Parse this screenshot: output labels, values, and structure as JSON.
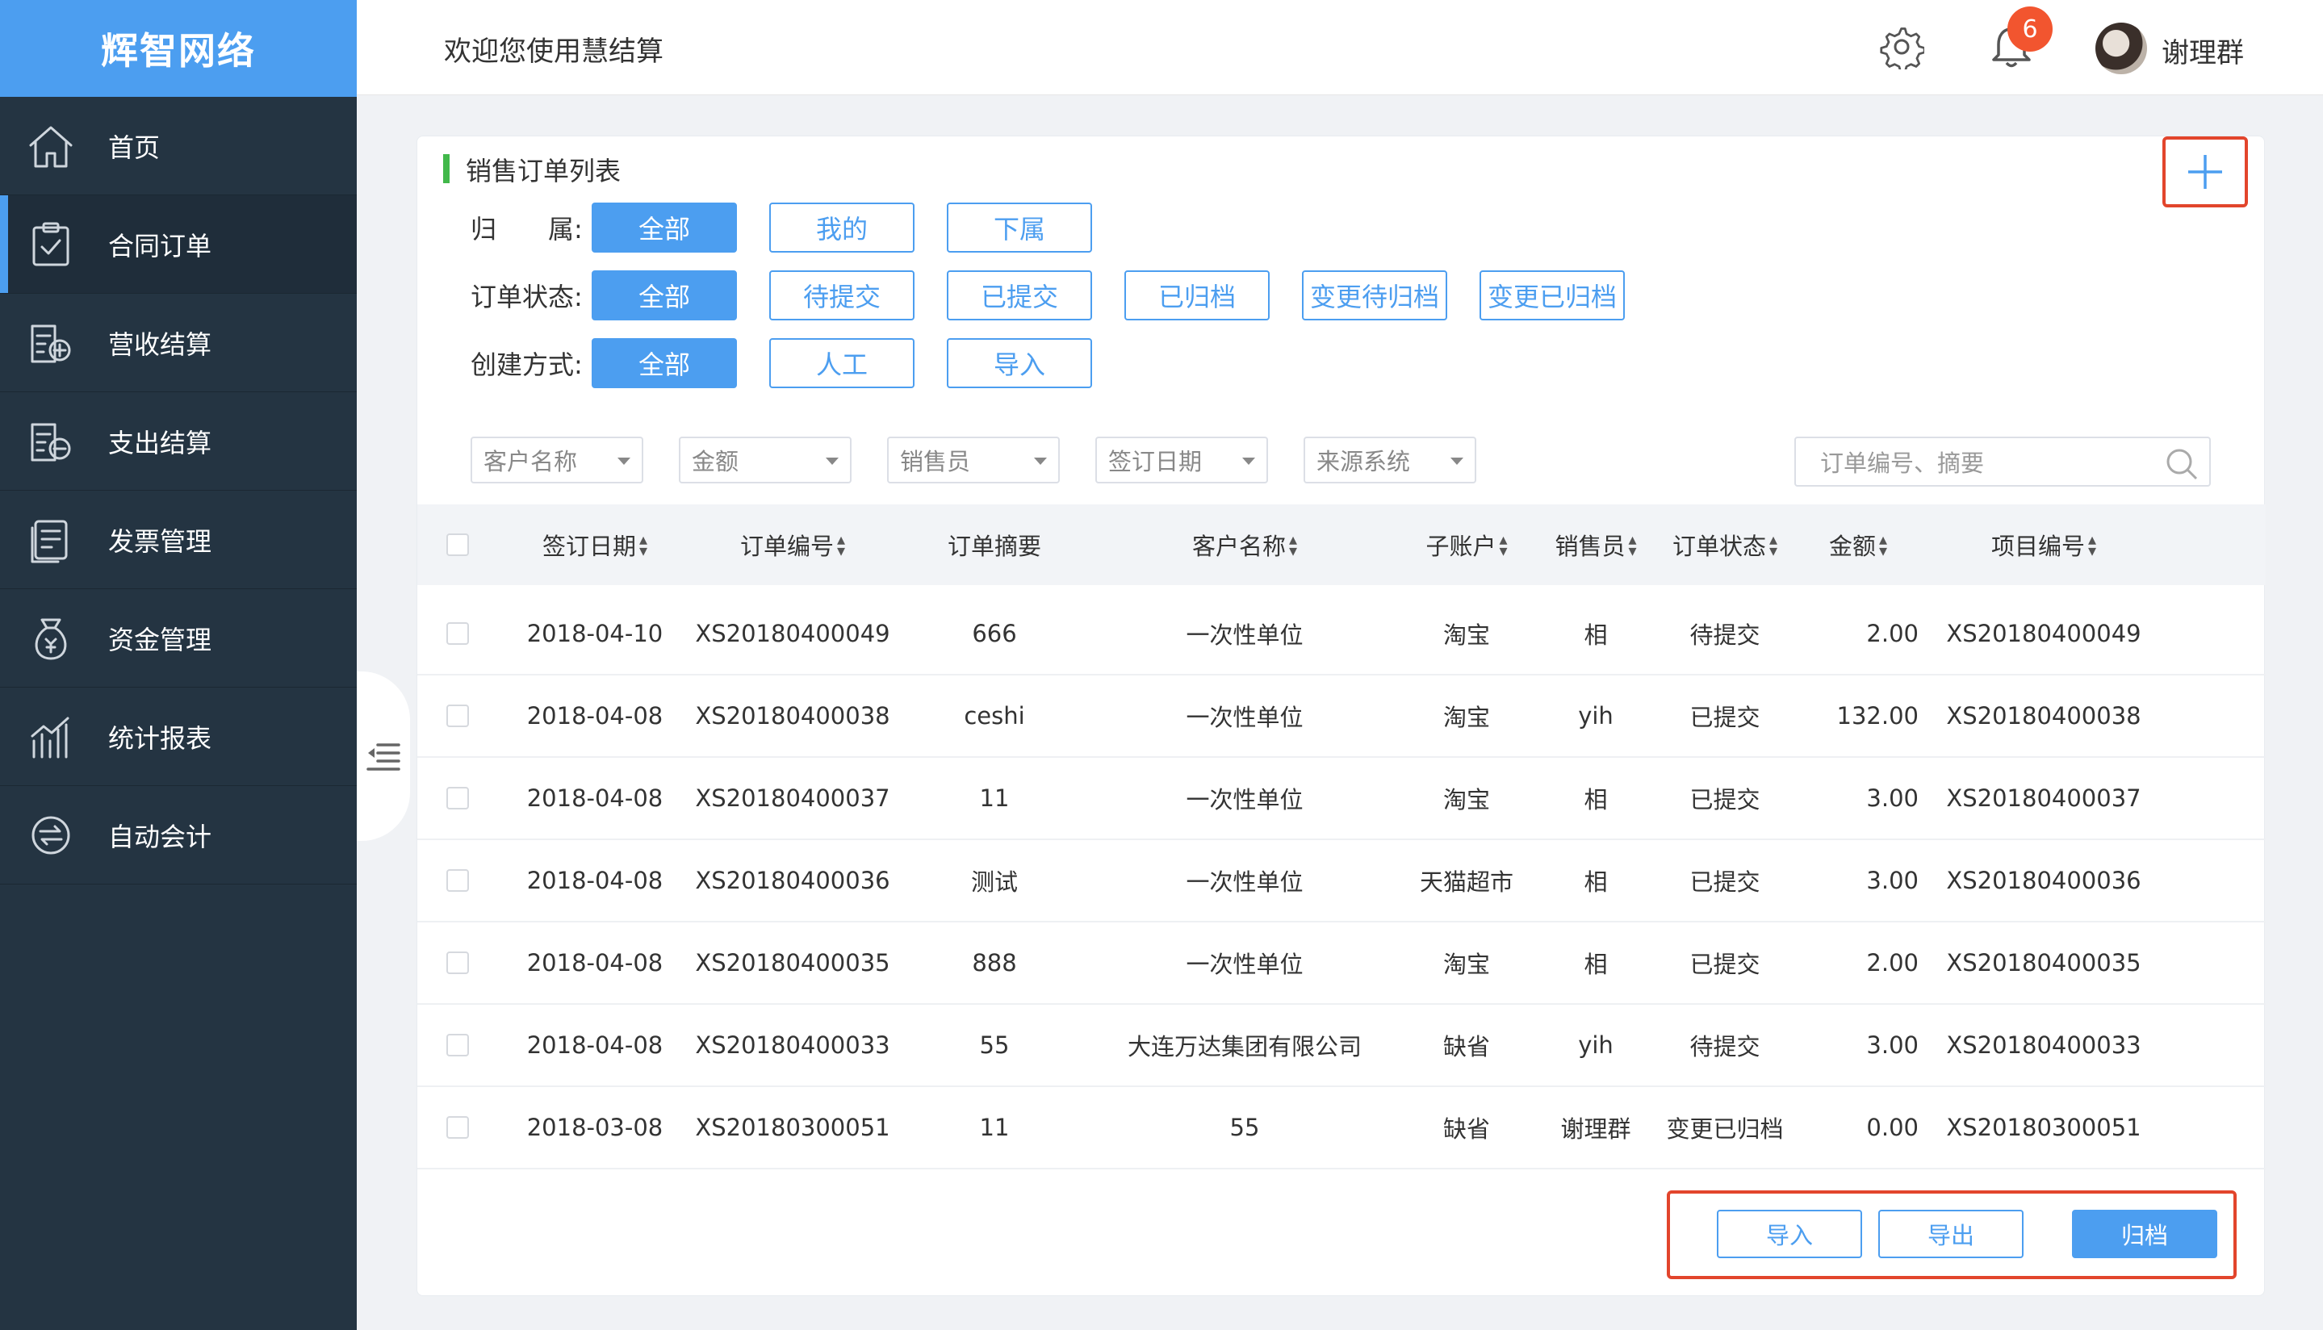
{
  "brand": "辉智网络",
  "header": {
    "welcome": "欢迎您使用慧结算",
    "notification_count": "6",
    "username": "谢理群"
  },
  "sidebar": {
    "items": [
      {
        "label": "首页",
        "icon": "home-icon"
      },
      {
        "label": "合同订单",
        "icon": "clipboard-icon"
      },
      {
        "label": "营收结算",
        "icon": "income-icon"
      },
      {
        "label": "支出结算",
        "icon": "expense-icon"
      },
      {
        "label": "发票管理",
        "icon": "invoice-icon"
      },
      {
        "label": "资金管理",
        "icon": "money-bag-icon"
      },
      {
        "label": "统计报表",
        "icon": "bar-chart-icon"
      },
      {
        "label": "自动会计",
        "icon": "sync-icon"
      }
    ],
    "active_index": 1
  },
  "card": {
    "title": "销售订单列表"
  },
  "filters": {
    "ownership": {
      "label": "归　　属:",
      "options": [
        "全部",
        "我的",
        "下属"
      ]
    },
    "status": {
      "label": "订单状态:",
      "options": [
        "全部",
        "待提交",
        "已提交",
        "已归档",
        "变更待归档",
        "变更已归档"
      ]
    },
    "method": {
      "label": "创建方式:",
      "options": [
        "全部",
        "人工",
        "导入"
      ]
    }
  },
  "selects": [
    "客户名称",
    "金额",
    "销售员",
    "签订日期",
    "来源系统"
  ],
  "search": {
    "placeholder": "订单编号、摘要"
  },
  "table": {
    "headers": [
      "签订日期",
      "订单编号",
      "订单摘要",
      "客户名称",
      "子账户",
      "销售员",
      "订单状态",
      "金额",
      "项目编号"
    ],
    "rows": [
      [
        "2018-04-10",
        "XS20180400049",
        "666",
        "一次性单位",
        "淘宝",
        "相",
        "待提交",
        "2.00",
        "XS20180400049"
      ],
      [
        "2018-04-08",
        "XS20180400038",
        "ceshi",
        "一次性单位",
        "淘宝",
        "yih",
        "已提交",
        "132.00",
        "XS20180400038"
      ],
      [
        "2018-04-08",
        "XS20180400037",
        "11",
        "一次性单位",
        "淘宝",
        "相",
        "已提交",
        "3.00",
        "XS20180400037"
      ],
      [
        "2018-04-08",
        "XS20180400036",
        "测试",
        "一次性单位",
        "天猫超市",
        "相",
        "已提交",
        "3.00",
        "XS20180400036"
      ],
      [
        "2018-04-08",
        "XS20180400035",
        "888",
        "一次性单位",
        "淘宝",
        "相",
        "已提交",
        "2.00",
        "XS20180400035"
      ],
      [
        "2018-04-08",
        "XS20180400033",
        "55",
        "大连万达集团有限公司",
        "缺省",
        "yih",
        "待提交",
        "3.00",
        "XS20180400033"
      ],
      [
        "2018-03-08",
        "XS20180300051",
        "11",
        "55",
        "缺省",
        "谢理群",
        "变更已归档",
        "0.00",
        "XS20180300051"
      ]
    ]
  },
  "footer": {
    "import": "导入",
    "export": "导出",
    "archive": "归档"
  },
  "colors": {
    "accent": "#4c9ef0",
    "sidebar": "#243442",
    "highlight": "#e2452c",
    "title_bar": "#41b84a"
  }
}
